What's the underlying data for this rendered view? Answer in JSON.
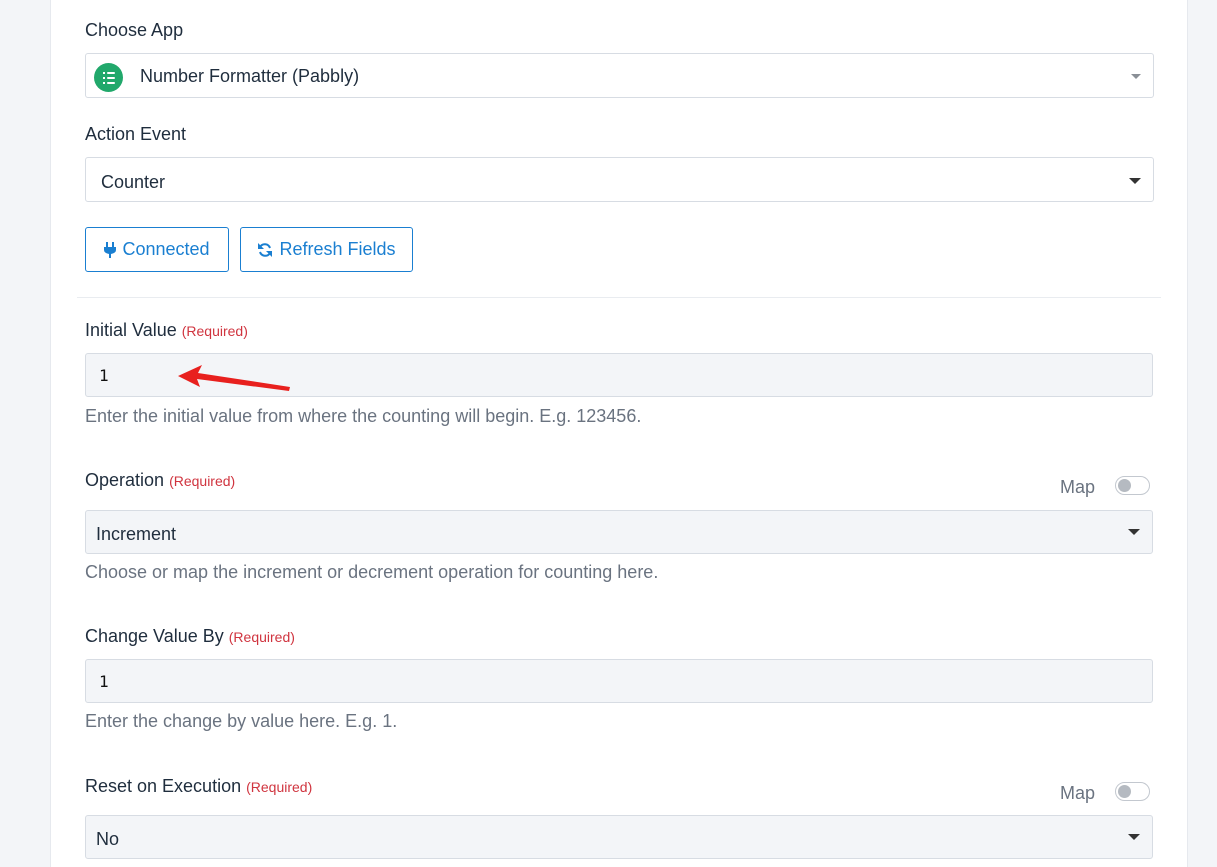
{
  "choose_app": {
    "label": "Choose App",
    "selected": "Number Formatter (Pabbly)",
    "icon": "list-icon",
    "icon_color": "#21a86b"
  },
  "action_event": {
    "label": "Action Event",
    "selected": "Counter"
  },
  "buttons": {
    "connected": {
      "label": "Connected",
      "icon": "plug-icon"
    },
    "refresh": {
      "label": "Refresh Fields",
      "icon": "refresh-icon"
    }
  },
  "required_text": "(Required)",
  "initial_value": {
    "label": "Initial Value",
    "value": "1",
    "hint": "Enter the initial value from where the counting will begin. E.g. 123456."
  },
  "operation": {
    "label": "Operation",
    "map_label": "Map",
    "selected": "Increment",
    "hint": "Choose or map the increment or decrement operation for counting here."
  },
  "change_value": {
    "label": "Change Value By",
    "value": "1",
    "hint": "Enter the change by value here. E.g. 1."
  },
  "reset_execution": {
    "label": "Reset on Execution",
    "map_label": "Map",
    "selected": "No"
  },
  "colors": {
    "accent": "#1a7fd1",
    "required": "#d0343f",
    "annotation_arrow": "#e8201e"
  }
}
